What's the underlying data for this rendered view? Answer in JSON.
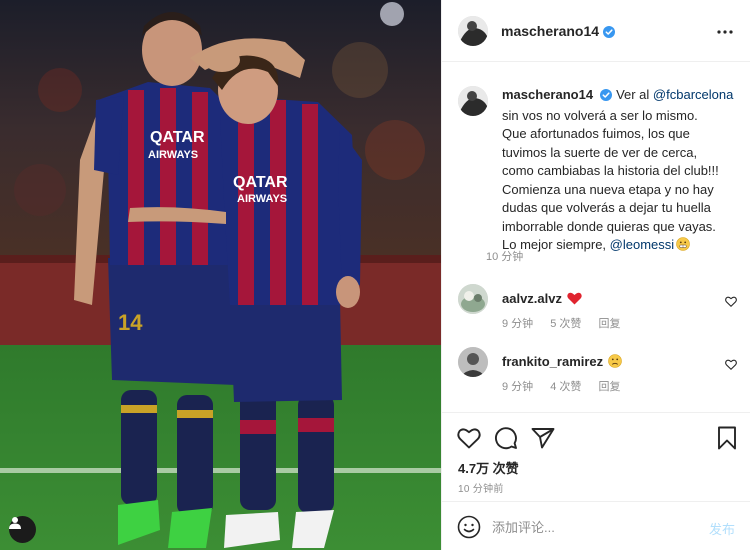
{
  "post": {
    "author": "mascherano14",
    "verified": true,
    "caption_user": "mascherano14",
    "caption_lines": [
      {
        "segments": [
          {
            "text": "Ver al "
          },
          {
            "text": "@fcbarcelona",
            "mention": true
          }
        ]
      },
      {
        "segments": [
          {
            "text": "sin vos no volverá a ser lo mismo."
          }
        ]
      },
      {
        "segments": [
          {
            "text": "Que afortunados fuimos, los que"
          }
        ]
      },
      {
        "segments": [
          {
            "text": "tuvimos la suerte de ver de cerca,"
          }
        ]
      },
      {
        "segments": [
          {
            "text": "como cambiabas la historia del club!!!"
          }
        ]
      },
      {
        "segments": [
          {
            "text": "Comienza una nueva etapa y no hay"
          }
        ]
      },
      {
        "segments": [
          {
            "text": "dudas que volverás a dejar tu huella"
          }
        ]
      },
      {
        "segments": [
          {
            "text": "imborrable donde quieras que vayas."
          }
        ]
      },
      {
        "segments": [
          {
            "text": "Lo mejor siempre, "
          },
          {
            "text": "@leomessi",
            "mention": true
          }
        ]
      }
    ],
    "caption_time": "10 分钟",
    "likes": "4.7万 次赞",
    "posted_ago": "10 分钟前"
  },
  "comments": [
    {
      "user": "aalvz.alvz",
      "emoji": "red-heart",
      "time": "9 分钟",
      "likes": "5 次赞",
      "reply": "回复"
    },
    {
      "user": "frankito_ramirez",
      "emoji": "frowning-face",
      "time": "9 分钟",
      "likes": "4 次赞",
      "reply": "回复"
    }
  ],
  "add_comment": {
    "placeholder": "添加评论...",
    "post_label": "发布"
  },
  "photo": {
    "shirt_text_1": "QATAR",
    "shirt_text_2": "AIRWAYS",
    "shirt_number": "14"
  },
  "colors": {
    "mention": "#00376b",
    "verified_blue": "#3897f0",
    "post_button_disabled": "#b2dffc",
    "muted": "#8e8e8e"
  }
}
